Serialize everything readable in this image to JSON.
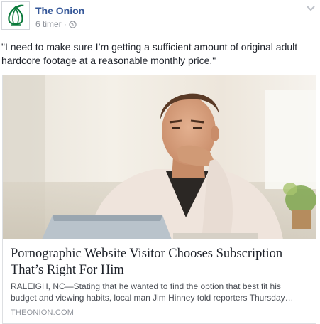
{
  "post": {
    "page_name": "The Onion",
    "time": "6 timer",
    "separator": "·",
    "privacy_icon": "globe-icon",
    "options_icon": "chevron-down-icon",
    "avatar_icon": "onion-logo",
    "text": "\"I need to make sure I’m getting a sufficient amount of original adult hardcore footage at a reasonable monthly price.\""
  },
  "link": {
    "title": "Pornographic Website Visitor Chooses Subscription That’s Right For Him",
    "description": "RALEIGH, NC—Stating that he wanted to find the option that best fit his budget and viewing habits, local man Jim Hinney told reporters Thursday…",
    "domain": "THEONION.COM"
  },
  "colors": {
    "brand_green": "#0b7a3b",
    "link_blue": "#365899",
    "meta_gray": "#90949c"
  }
}
